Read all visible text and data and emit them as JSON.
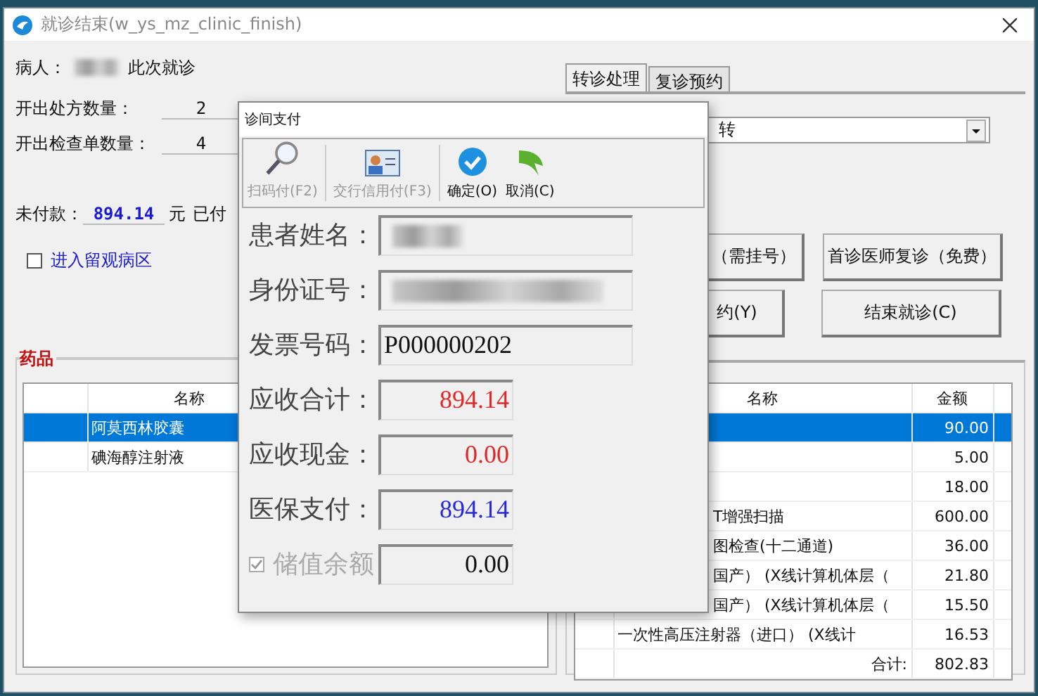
{
  "window": {
    "title": "就诊结束(w_ys_mz_clinic_finish)"
  },
  "patient": {
    "label": "病人：",
    "suffix": "此次就诊"
  },
  "counts": [
    {
      "label": "开出处方数量：",
      "value": "2"
    },
    {
      "label": "开出检查单数量：",
      "value": "4"
    }
  ],
  "payment": {
    "label": "未付款：",
    "amount": "894.14",
    "unit": "元",
    "paid_label": "已付"
  },
  "observation": {
    "label": "进入留观病区",
    "checked": false
  },
  "drugs": {
    "title": "药品",
    "columns": [
      "名称"
    ],
    "rows": [
      {
        "name": "阿莫西林胶囊",
        "selected": true
      },
      {
        "name": "碘海醇注射液",
        "selected": false
      }
    ]
  },
  "tabs": [
    {
      "label": "转诊处理",
      "selected": true
    },
    {
      "label": "复诊预约",
      "selected": false
    }
  ],
  "combo": {
    "value": "转"
  },
  "buttons": [
    [
      {
        "label": "（需挂号）"
      },
      {
        "label": "首诊医师复诊（免费）"
      }
    ],
    [
      {
        "label": "约(Y)"
      },
      {
        "label": "结束就诊(C)"
      }
    ]
  ],
  "fees": {
    "columns": [
      "名称",
      "金额"
    ],
    "rows": [
      {
        "amount": "90.00",
        "selected": true
      },
      {
        "amount": "5.00",
        "selected": false
      },
      {
        "amount": "18.00",
        "selected": false
      },
      {
        "name": "T增强扫描",
        "covered": true,
        "amount": "600.00",
        "selected": false
      },
      {
        "name": "图检查(十二通道)",
        "covered": true,
        "amount": "36.00",
        "selected": false
      },
      {
        "name": "国产） (X线计算机体层（",
        "covered": true,
        "amount": "21.80",
        "selected": false
      },
      {
        "name": "国产） (X线计算机体层（",
        "covered": true,
        "amount": "15.50",
        "selected": false
      },
      {
        "name": "一次性高压注射器（进口） (X线计",
        "covered": false,
        "amount": "16.53",
        "selected": false
      }
    ],
    "total": {
      "label": "合计:",
      "amount": "802.83"
    }
  },
  "dialog": {
    "title": "诊间支付",
    "toolbar": [
      {
        "kind": "scan",
        "label": "扫码付(F2)",
        "disabled": true
      },
      {
        "kind": "card",
        "label": "交行信用付(F3)",
        "disabled": true
      },
      {
        "kind": "confirm",
        "label": "确定(O)",
        "disabled": false
      },
      {
        "kind": "cancel",
        "label": "取消(C)",
        "disabled": false
      }
    ],
    "fields": [
      {
        "kind": "blurred",
        "label": "患者姓名："
      },
      {
        "kind": "blurred",
        "label": "身份证号："
      },
      {
        "kind": "text",
        "label": "发票号码：",
        "value": "P000000202"
      },
      {
        "kind": "amount",
        "label": "应收合计：",
        "value": "894.14",
        "color": "#e02828"
      },
      {
        "kind": "amount",
        "label": "应收现金：",
        "value": "0.00",
        "color": "#e02828"
      },
      {
        "kind": "amount",
        "label": "医保支付：",
        "value": "894.14",
        "color": "#2828d8"
      },
      {
        "kind": "check",
        "label": "储值余额",
        "checked": true,
        "value": "0.00",
        "color": "#111111"
      }
    ]
  }
}
